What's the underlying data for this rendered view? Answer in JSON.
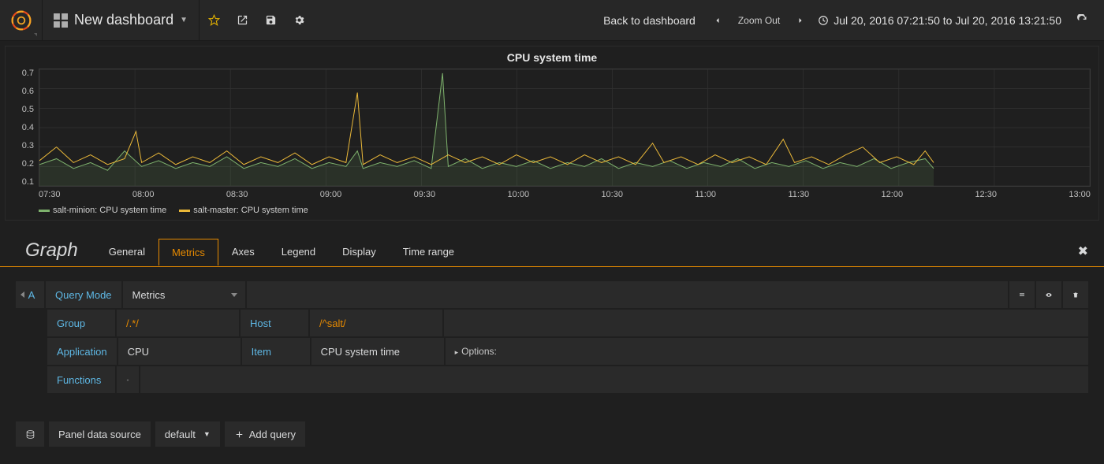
{
  "navbar": {
    "dashboard_title": "New dashboard",
    "back_label": "Back to dashboard",
    "zoom_label": "Zoom Out",
    "time_range": "Jul 20, 2016 07:21:50 to Jul 20, 2016 13:21:50"
  },
  "panel": {
    "title": "CPU system time"
  },
  "chart_data": {
    "type": "line",
    "title": "CPU system time",
    "xlabel": "",
    "ylabel": "",
    "ylim": [
      0.1,
      0.7
    ],
    "y_ticks": [
      "0.7",
      "0.6",
      "0.5",
      "0.4",
      "0.3",
      "0.2",
      "0.1"
    ],
    "x_ticks": [
      "07:30",
      "08:00",
      "08:30",
      "09:00",
      "09:30",
      "10:00",
      "10:30",
      "11:00",
      "11:30",
      "12:00",
      "12:30",
      "13:00"
    ],
    "x_range_minutes": [
      430,
      800
    ],
    "series": [
      {
        "name": "salt-minion: CPU system time",
        "color": "#7eb26d",
        "values": [
          [
            430,
            0.21
          ],
          [
            436,
            0.24
          ],
          [
            442,
            0.19
          ],
          [
            448,
            0.22
          ],
          [
            454,
            0.18
          ],
          [
            460,
            0.28
          ],
          [
            466,
            0.2
          ],
          [
            472,
            0.23
          ],
          [
            478,
            0.19
          ],
          [
            484,
            0.22
          ],
          [
            490,
            0.2
          ],
          [
            496,
            0.25
          ],
          [
            502,
            0.19
          ],
          [
            508,
            0.22
          ],
          [
            514,
            0.2
          ],
          [
            520,
            0.24
          ],
          [
            526,
            0.19
          ],
          [
            532,
            0.22
          ],
          [
            538,
            0.2
          ],
          [
            542,
            0.28
          ],
          [
            544,
            0.19
          ],
          [
            550,
            0.22
          ],
          [
            556,
            0.2
          ],
          [
            562,
            0.23
          ],
          [
            568,
            0.19
          ],
          [
            572,
            0.68
          ],
          [
            574,
            0.2
          ],
          [
            580,
            0.24
          ],
          [
            586,
            0.19
          ],
          [
            592,
            0.22
          ],
          [
            598,
            0.2
          ],
          [
            604,
            0.23
          ],
          [
            610,
            0.19
          ],
          [
            616,
            0.22
          ],
          [
            622,
            0.2
          ],
          [
            628,
            0.24
          ],
          [
            634,
            0.19
          ],
          [
            640,
            0.22
          ],
          [
            646,
            0.2
          ],
          [
            652,
            0.23
          ],
          [
            658,
            0.19
          ],
          [
            664,
            0.22
          ],
          [
            670,
            0.2
          ],
          [
            676,
            0.24
          ],
          [
            682,
            0.19
          ],
          [
            688,
            0.22
          ],
          [
            694,
            0.2
          ],
          [
            700,
            0.23
          ],
          [
            706,
            0.19
          ],
          [
            712,
            0.22
          ],
          [
            718,
            0.2
          ],
          [
            724,
            0.24
          ],
          [
            730,
            0.19
          ],
          [
            736,
            0.22
          ],
          [
            742,
            0.24
          ],
          [
            745,
            0.19
          ]
        ]
      },
      {
        "name": "salt-master: CPU system time",
        "color": "#eab839",
        "values": [
          [
            430,
            0.23
          ],
          [
            436,
            0.3
          ],
          [
            442,
            0.22
          ],
          [
            448,
            0.26
          ],
          [
            454,
            0.21
          ],
          [
            460,
            0.24
          ],
          [
            464,
            0.38
          ],
          [
            466,
            0.22
          ],
          [
            472,
            0.27
          ],
          [
            478,
            0.21
          ],
          [
            484,
            0.25
          ],
          [
            490,
            0.22
          ],
          [
            496,
            0.28
          ],
          [
            502,
            0.21
          ],
          [
            508,
            0.25
          ],
          [
            514,
            0.22
          ],
          [
            520,
            0.27
          ],
          [
            526,
            0.21
          ],
          [
            532,
            0.25
          ],
          [
            538,
            0.22
          ],
          [
            542,
            0.58
          ],
          [
            544,
            0.21
          ],
          [
            550,
            0.26
          ],
          [
            556,
            0.22
          ],
          [
            562,
            0.25
          ],
          [
            568,
            0.21
          ],
          [
            574,
            0.26
          ],
          [
            580,
            0.22
          ],
          [
            586,
            0.25
          ],
          [
            592,
            0.21
          ],
          [
            598,
            0.26
          ],
          [
            604,
            0.22
          ],
          [
            610,
            0.25
          ],
          [
            616,
            0.21
          ],
          [
            622,
            0.26
          ],
          [
            628,
            0.22
          ],
          [
            634,
            0.25
          ],
          [
            640,
            0.21
          ],
          [
            646,
            0.32
          ],
          [
            650,
            0.22
          ],
          [
            656,
            0.25
          ],
          [
            662,
            0.21
          ],
          [
            668,
            0.26
          ],
          [
            674,
            0.22
          ],
          [
            680,
            0.25
          ],
          [
            686,
            0.21
          ],
          [
            692,
            0.34
          ],
          [
            696,
            0.22
          ],
          [
            702,
            0.25
          ],
          [
            708,
            0.21
          ],
          [
            714,
            0.26
          ],
          [
            720,
            0.3
          ],
          [
            726,
            0.22
          ],
          [
            732,
            0.25
          ],
          [
            738,
            0.21
          ],
          [
            742,
            0.28
          ],
          [
            745,
            0.22
          ]
        ]
      }
    ]
  },
  "editor": {
    "panel_type": "Graph",
    "tabs": [
      "General",
      "Metrics",
      "Axes",
      "Legend",
      "Display",
      "Time range"
    ],
    "active_tab": "Metrics"
  },
  "query": {
    "letter": "A",
    "mode_label": "Query Mode",
    "mode_value": "Metrics",
    "group_label": "Group",
    "group_value": "/.*/",
    "host_label": "Host",
    "host_value": "/^salt/",
    "application_label": "Application",
    "application_value": "CPU",
    "item_label": "Item",
    "item_value": "CPU system time",
    "options_label": "Options:",
    "functions_label": "Functions"
  },
  "footer": {
    "ds_label": "Panel data source",
    "ds_value": "default",
    "add_query": "Add query"
  }
}
